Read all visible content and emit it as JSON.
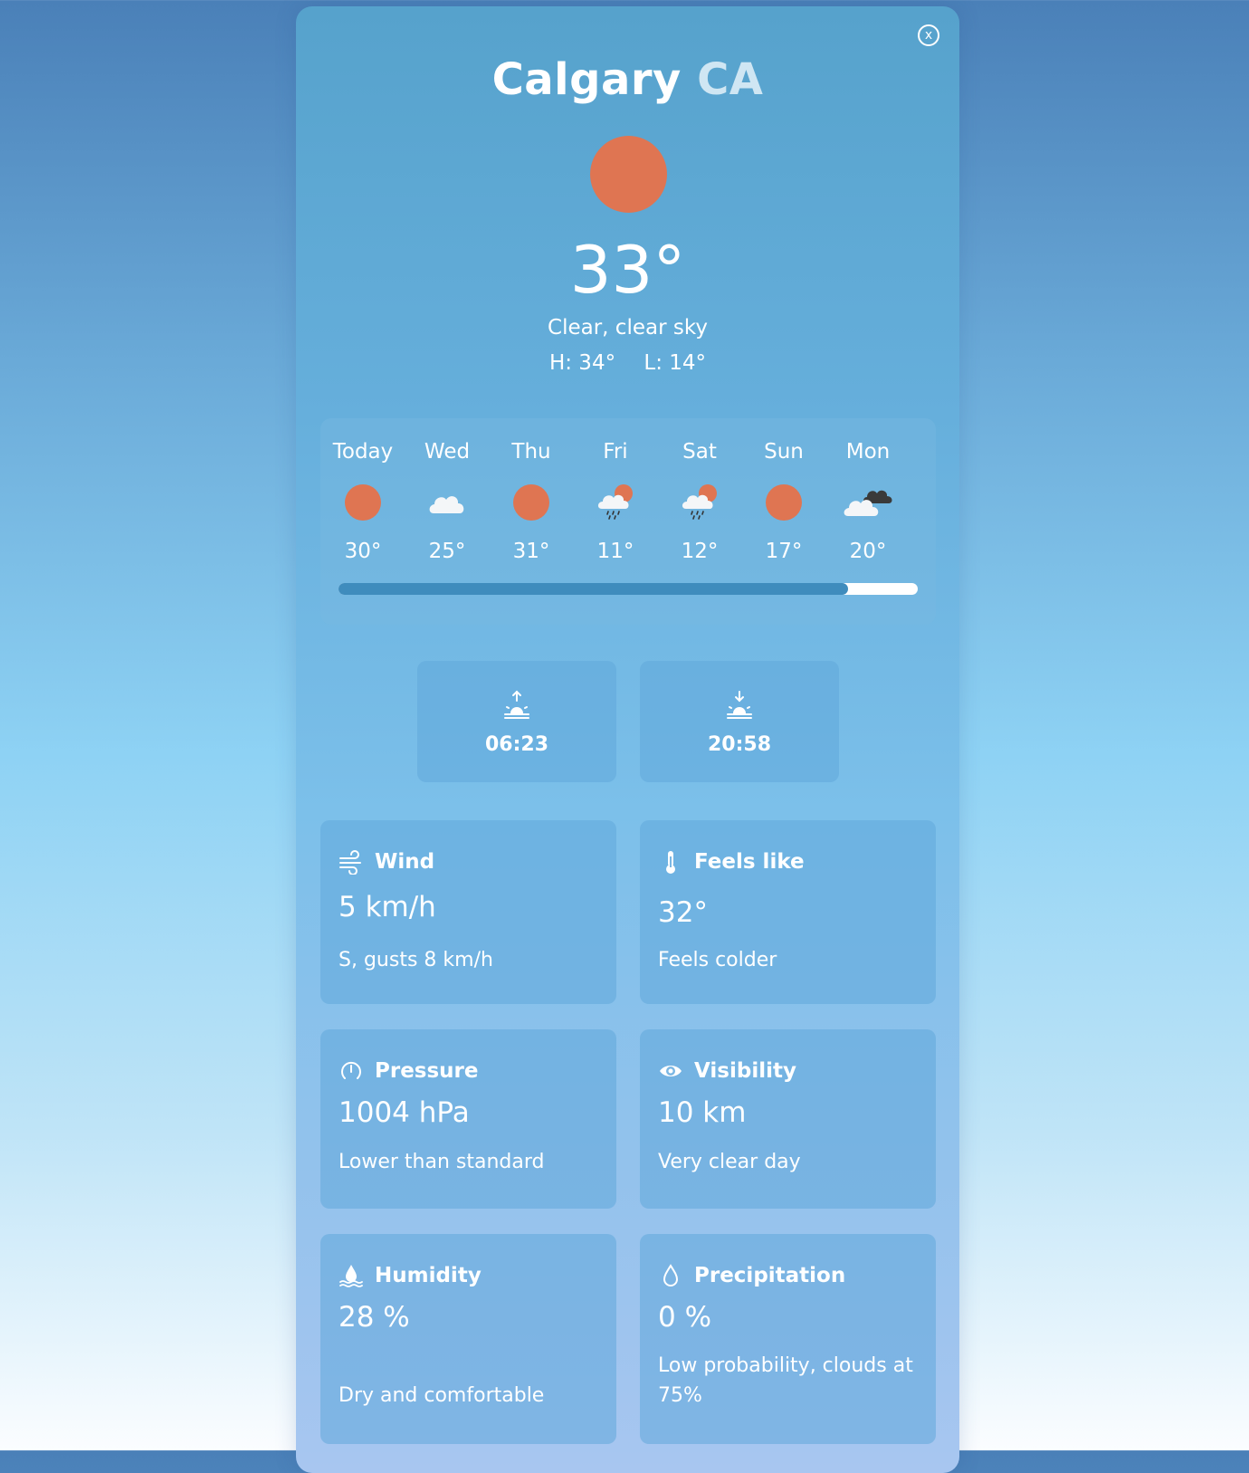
{
  "header": {
    "city": "Calgary",
    "country": "CA",
    "close_label": "x"
  },
  "current": {
    "icon": "sun-icon",
    "temperature": "33",
    "degree": "°",
    "description": "Clear, clear sky",
    "high": "H: 34°",
    "low": "L: 14°"
  },
  "forecast": {
    "days": [
      {
        "day": "Today",
        "icon": "sun-icon",
        "temp": "30°"
      },
      {
        "day": "Wed",
        "icon": "cloud-icon",
        "temp": "25°"
      },
      {
        "day": "Thu",
        "icon": "sun-icon",
        "temp": "31°"
      },
      {
        "day": "Fri",
        "icon": "rain-sun-icon",
        "temp": "11°"
      },
      {
        "day": "Sat",
        "icon": "rain-sun-icon",
        "temp": "12°"
      },
      {
        "day": "Sun",
        "icon": "sun-icon",
        "temp": "17°"
      },
      {
        "day": "Mon",
        "icon": "dark-clouds-icon",
        "temp": "20°"
      }
    ],
    "scroll_progress": 0.88
  },
  "sun": {
    "sunrise": "06:23",
    "sunset": "20:58"
  },
  "cards": {
    "wind": {
      "title": "Wind",
      "value": "5 km/h",
      "note": "S, gusts 8 km/h"
    },
    "feels": {
      "title": "Feels like",
      "value": "32°",
      "note": "Feels colder"
    },
    "pressure": {
      "title": "Pressure",
      "value": "1004 hPa",
      "note": "Lower than standard"
    },
    "visibility": {
      "title": "Visibility",
      "value": "10 km",
      "note": "Very clear day"
    },
    "humidity": {
      "title": "Humidity",
      "value": "28 %",
      "note": "Dry and comfortable"
    },
    "precip": {
      "title": "Precipitation",
      "value": "0 %",
      "note": "Low probability, clouds at 75%"
    }
  },
  "colors": {
    "sun": "#df7552",
    "scroll_thumb": "#3f8cbd",
    "dark_cloud": "#3a3a3a"
  }
}
